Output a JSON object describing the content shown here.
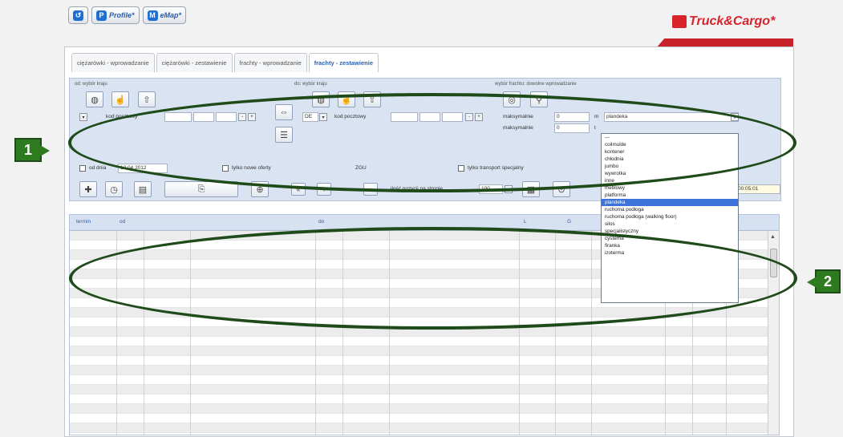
{
  "toolbar": {
    "profile_label": "Profile*",
    "emap_label": "eMap*"
  },
  "brand": "Truck&Cargo*",
  "tabs": [
    {
      "label": "ciężarówki - wprowadzanie"
    },
    {
      "label": "ciężarówki - zestawienie"
    },
    {
      "label": "frachty - wprowadzanie"
    },
    {
      "label": "frachty - zestawienie"
    }
  ],
  "filters": {
    "from_label": "od: wybór kraju",
    "to_label": "do: wybór kraju",
    "vehicle_label": "wybór frachtu: dowolne wprowadzanie",
    "postal_code_label": "kod pocztowy",
    "to_country": "DE",
    "max_label": "maksymalnie",
    "max1": "0",
    "max2": "0",
    "unit_m": "m",
    "unit_t": "t",
    "body_type": "plandeka",
    "date_label": "od dnia",
    "date_value": "12.04.2012",
    "only_new": "tylko nowe oferty",
    "zgu": "ZGU",
    "special_transport": "tylko transport specjalny",
    "rows_per_page_label": "ilość pozycji na stronie",
    "rows_per_page": "100",
    "time": "00:05:01"
  },
  "dropdown_options": [
    "---",
    "coilmulde",
    "kontener",
    "chłodnia",
    "jumbo",
    "wywrotka",
    "inne",
    "meblowy",
    "platforma",
    "plandeka",
    "ruchoma podłoga",
    "ruchoma podłoga (walking floor)",
    "silos",
    "specjalistyczny",
    "cysterna",
    "firanka",
    "izoterma"
  ],
  "grid": {
    "col_termin": "termin",
    "col_od": "od",
    "col_do": "do",
    "col_l": "L",
    "col_g": "G"
  },
  "annotations": {
    "one": "1",
    "two": "2"
  }
}
